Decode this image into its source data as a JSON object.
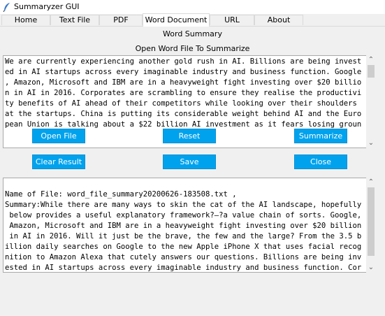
{
  "window": {
    "title": "Summaryzer GUI",
    "icon": "feather-icon"
  },
  "tabs": [
    {
      "label": "Home",
      "active": false
    },
    {
      "label": "Text File",
      "active": false
    },
    {
      "label": "PDF",
      "active": false
    },
    {
      "label": "Word Document",
      "active": true
    },
    {
      "label": "URL",
      "active": false
    },
    {
      "label": "About",
      "active": false
    }
  ],
  "word_panel": {
    "heading": "Word Summary",
    "instruction": "Open Word File To Summarize",
    "input_text": "We are currently experiencing another gold rush in AI. Billions are being invest\ned in AI startups across every imaginable industry and business function. Google\n, Amazon, Microsoft and IBM are in a heavyweight fight investing over $20 billio\nn in AI in 2016. Corporates are scrambling to ensure they realise the productivi\nty benefits of AI ahead of their competitors while looking over their shoulders\nat the startups. China is putting its considerable weight behind AI and the Euro\npean Union is talking about a $22 billion AI investment as it fears losing groun",
    "buttons": {
      "open_file": "Open File",
      "reset": "Reset",
      "summarize": "Summarize",
      "clear_result": "Clear Result",
      "save": "Save",
      "close": "Close"
    },
    "result_text": "\nName of File: word_file_summary20200626-183508.txt ,\nSummary:While there are many ways to skin the cat of the AI landscape, hopefully\n below provides a useful explanatory framework?—?a value chain of sorts. Google,\n Amazon, Microsoft and IBM are in a heavyweight fight investing over $20 billion\n in AI in 2016. Will it just be the brave, the few and the large? From the 3.5 b\nillion daily searches on Google to the new Apple iPhone X that uses facial recog\nnition to Amazon Alexa that cutely answers our questions. Billions are being inv\nested in AI startups across every imaginable industry and business function. Cor\nporates are scrambling to ensure they realise the productivity benefits of AI ah"
  },
  "colors": {
    "button_bg": "#00a2ed",
    "button_text": "#ffffff"
  }
}
